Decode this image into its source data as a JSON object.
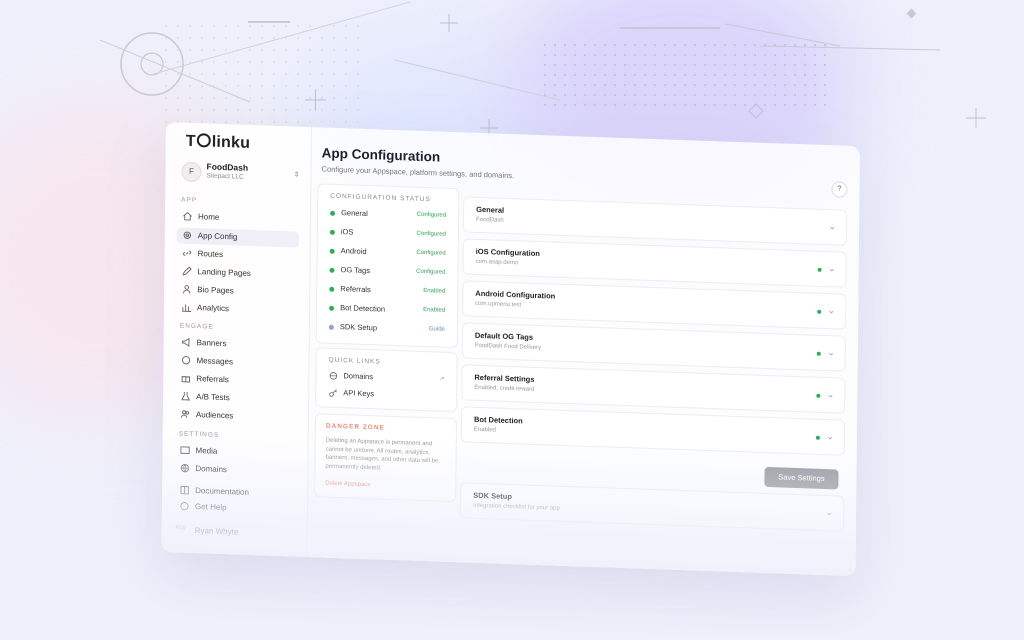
{
  "brand": {
    "logo_prefix": "T",
    "logo_suffix": "linku"
  },
  "workspace": {
    "initial": "F",
    "name": "FoodDash",
    "org": "Sitepact LLC"
  },
  "sidebar": {
    "sections": {
      "app": "APP",
      "engage": "ENGAGE",
      "settings": "SETTINGS"
    },
    "app_items": [
      {
        "label": "Home",
        "icon": "home-icon"
      },
      {
        "label": "App Config",
        "icon": "gear-icon",
        "active": true
      },
      {
        "label": "Routes",
        "icon": "link-icon"
      },
      {
        "label": "Landing Pages",
        "icon": "pencil-icon"
      },
      {
        "label": "Bio Pages",
        "icon": "user-icon"
      },
      {
        "label": "Analytics",
        "icon": "bar-chart-icon"
      }
    ],
    "engage_items": [
      {
        "label": "Banners",
        "icon": "megaphone-icon"
      },
      {
        "label": "Messages",
        "icon": "chat-icon"
      },
      {
        "label": "Referrals",
        "icon": "gift-icon"
      },
      {
        "label": "A/B Tests",
        "icon": "flask-icon"
      },
      {
        "label": "Audiences",
        "icon": "users-icon"
      }
    ],
    "settings_items": [
      {
        "label": "Media",
        "icon": "image-icon"
      },
      {
        "label": "Domains",
        "icon": "globe-icon"
      }
    ],
    "footer_items": [
      {
        "label": "Documentation",
        "icon": "book-icon"
      },
      {
        "label": "Get Help",
        "icon": "help-icon"
      }
    ],
    "user": {
      "initials": "RW",
      "name": "Ryan Whyte"
    }
  },
  "header": {
    "title": "App Configuration",
    "subtitle": "Configure your Appspace, platform settings, and domains.",
    "help": "?"
  },
  "config_status": {
    "title": "CONFIGURATION STATUS",
    "items": [
      {
        "label": "General",
        "status": "Configured"
      },
      {
        "label": "iOS",
        "status": "Configured"
      },
      {
        "label": "Android",
        "status": "Configured"
      },
      {
        "label": "OG Tags",
        "status": "Configured"
      },
      {
        "label": "Referrals",
        "status": "Enabled"
      },
      {
        "label": "Bot Detection",
        "status": "Enabled"
      },
      {
        "label": "SDK Setup",
        "status": "Guide"
      }
    ]
  },
  "quick_links": {
    "title": "QUICK LINKS",
    "items": [
      {
        "label": "Domains",
        "icon": "globe-icon"
      },
      {
        "label": "API Keys",
        "icon": "key-icon"
      }
    ]
  },
  "danger_zone": {
    "title": "DANGER ZONE",
    "text": "Deleting an Appspace is permanent and cannot be undone. All routes, analytics, banners, messages, and other data will be permanently deleted.",
    "action": "Delete Appspace"
  },
  "config_cards": [
    {
      "title": "General",
      "subtitle": "FoodDash",
      "configured": false
    },
    {
      "title": "iOS Configuration",
      "subtitle": "com.asap.demo",
      "configured": true
    },
    {
      "title": "Android Configuration",
      "subtitle": "com.upmenu.test",
      "configured": true
    },
    {
      "title": "Default OG Tags",
      "subtitle": "FoodDash Food Delivery",
      "configured": true
    },
    {
      "title": "Referral Settings",
      "subtitle": "Enabled, credit reward",
      "configured": true
    },
    {
      "title": "Bot Detection",
      "subtitle": "Enabled",
      "configured": true
    }
  ],
  "save_button": "Save Settings",
  "sdk_card": {
    "title": "SDK Setup",
    "subtitle": "Integration checklist for your app"
  },
  "colors": {
    "accent_green": "#2fae5e",
    "danger": "#e58d7b",
    "background": "#eef0fb"
  }
}
